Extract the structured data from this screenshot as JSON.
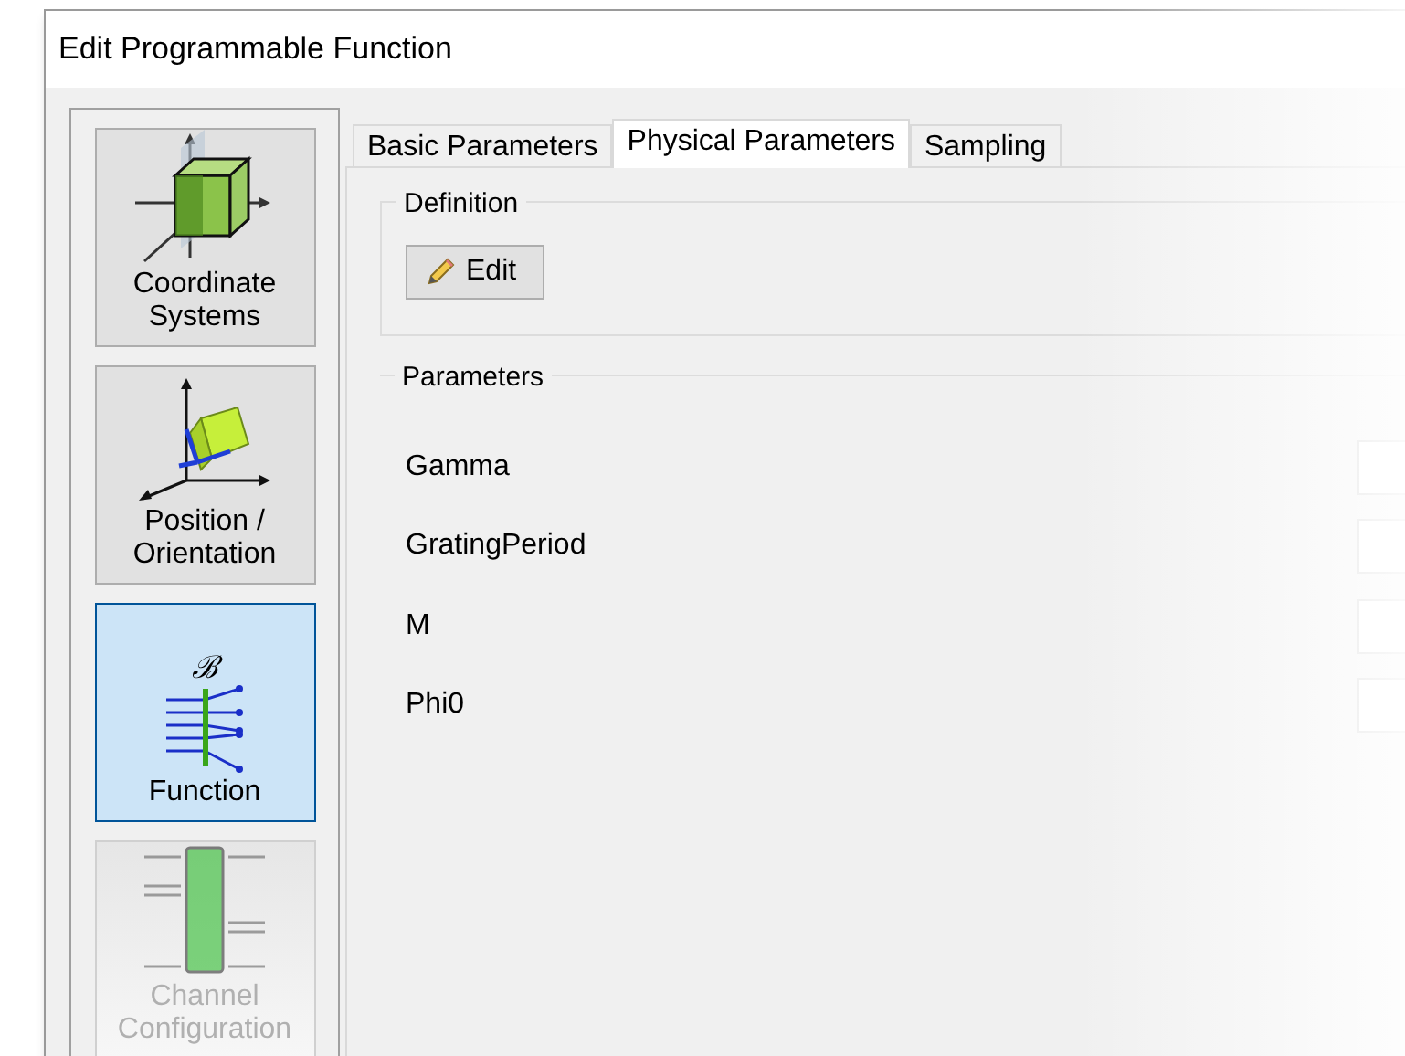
{
  "window": {
    "title": "Edit Programmable Function"
  },
  "sidebar": {
    "items": [
      {
        "kind": "coordinates",
        "label": "Coordinate Systems",
        "selected": false,
        "disabled": false
      },
      {
        "kind": "position",
        "label": "Position / Orientation",
        "selected": false,
        "disabled": false
      },
      {
        "kind": "function",
        "label": "Function",
        "symbol": "ℬ",
        "selected": true,
        "disabled": false
      },
      {
        "kind": "channel",
        "label": "Channel Configuration",
        "selected": false,
        "disabled": true
      }
    ]
  },
  "tabs": [
    {
      "label": "Basic Parameters",
      "selected": false
    },
    {
      "label": "Physical Parameters",
      "selected": true
    },
    {
      "label": "Sampling",
      "selected": false
    }
  ],
  "definition": {
    "title": "Definition",
    "edit_button": "Edit"
  },
  "parameters": {
    "title": "Parameters",
    "rows": [
      {
        "label": "Gamma"
      },
      {
        "label": "GratingPeriod"
      },
      {
        "label": "M"
      },
      {
        "label": "Phi0"
      }
    ]
  }
}
